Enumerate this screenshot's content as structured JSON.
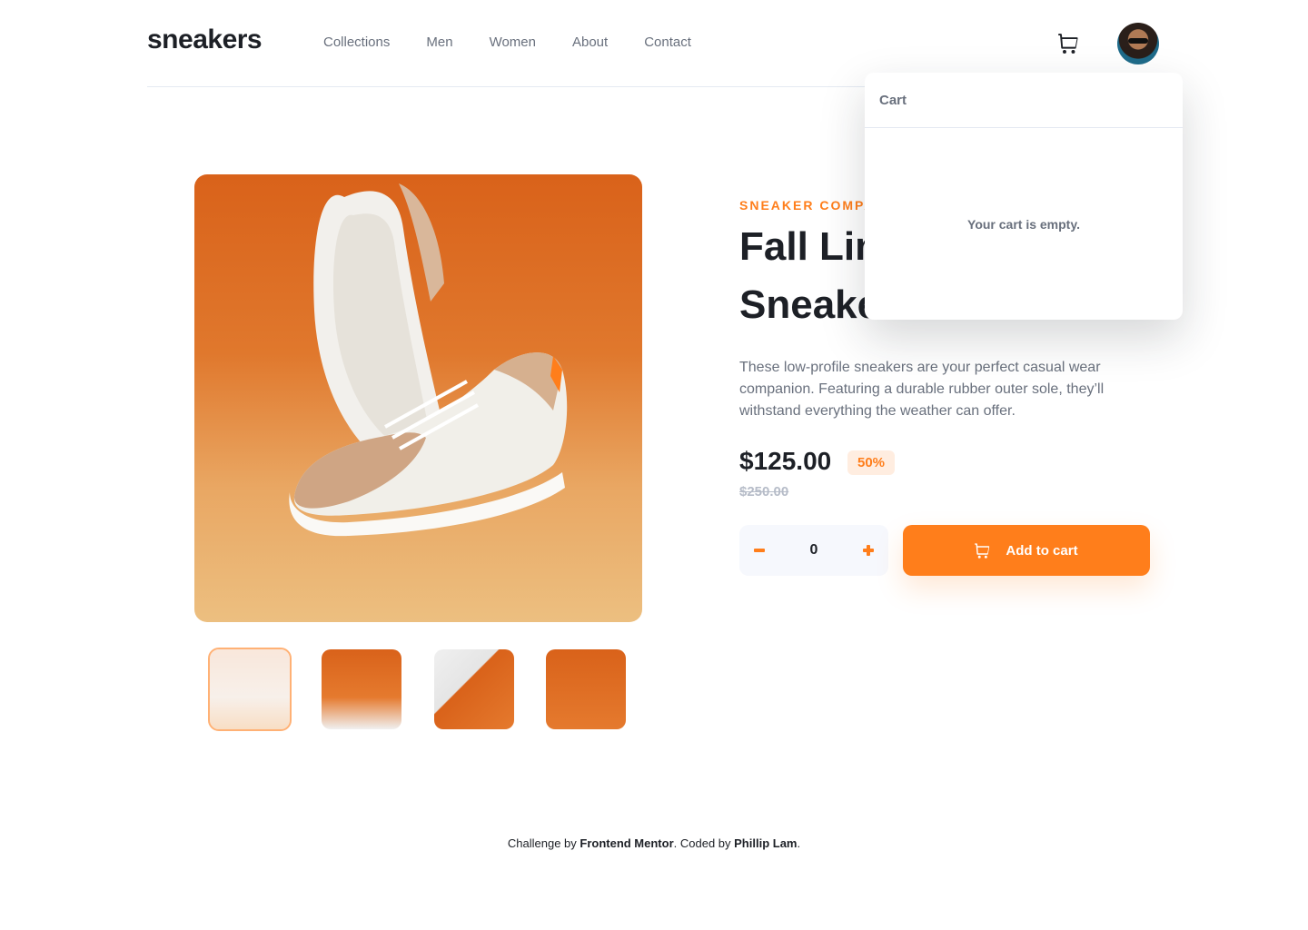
{
  "header": {
    "logo": "sneakers",
    "nav": [
      "Collections",
      "Men",
      "Women",
      "About",
      "Contact"
    ],
    "cart_icon": "cart-icon",
    "avatar_icon": "user-avatar"
  },
  "cart": {
    "title": "Cart",
    "empty_message": "Your cart is empty."
  },
  "product": {
    "company": "SNEAKER COMPANY",
    "title": "Fall Limited Edition Sneakers",
    "description": "These low-profile sneakers are your perfect casual wear companion. Featuring a durable rubber outer sole, they’ll withstand everything the weather can offer.",
    "price": "$125.00",
    "discount": "50%",
    "original_price": "$250.00",
    "quantity": "0",
    "add_to_cart": "Add to cart",
    "thumbnails_selected": 1
  },
  "footer": {
    "prefix": "Challenge by ",
    "challenge_by": "Frontend Mentor",
    "middle": ". Coded by ",
    "coded_by": "Phillip Lam",
    "suffix": "."
  },
  "colors": {
    "accent": "#ff7e1b",
    "accent_pale": "#ffede0",
    "text_dark": "#1d2026",
    "text_grey": "#69707d"
  }
}
